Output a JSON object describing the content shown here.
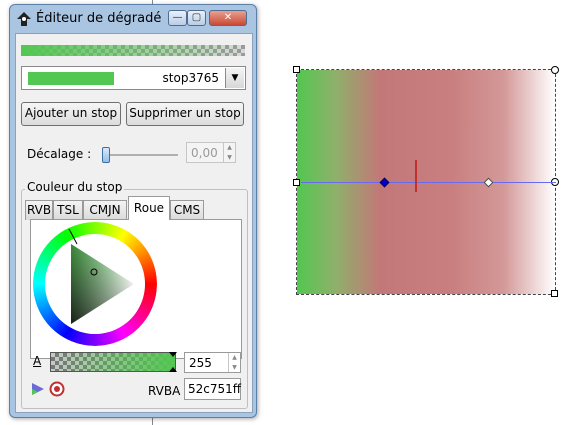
{
  "window": {
    "title": "Éditeur de dégradé"
  },
  "stop_select": {
    "value": "stop3765",
    "swatch_color": "#52c751"
  },
  "buttons": {
    "add_stop": "Ajouter un stop",
    "remove_stop": "Supprimer un stop"
  },
  "offset": {
    "label": "Décalage :",
    "value": "0,00",
    "slider_fraction": 0.0
  },
  "stop_color": {
    "group_title": "Couleur du stop",
    "tabs": [
      "RVB",
      "TSL",
      "CMJN",
      "Roue",
      "CMS"
    ],
    "active_tab": "Roue",
    "alpha_label": "A",
    "alpha_value": "255",
    "rgba_label": "RVBA :",
    "rgba_value": "52c751ff"
  },
  "colors": {
    "stop_color": "#52c751",
    "mid_color": "#c97f7f",
    "end_color": "#ffffff",
    "gradient_line": "#6a6af0",
    "selected_stop": "#0000cc",
    "mid_marker": "#c03030"
  },
  "icons": [
    "app-icon",
    "minimize-icon",
    "maximize-icon",
    "close-icon",
    "dropdown-arrow-icon",
    "spin-up-icon",
    "spin-down-icon",
    "color-managed-icon",
    "out-of-gamut-icon"
  ]
}
